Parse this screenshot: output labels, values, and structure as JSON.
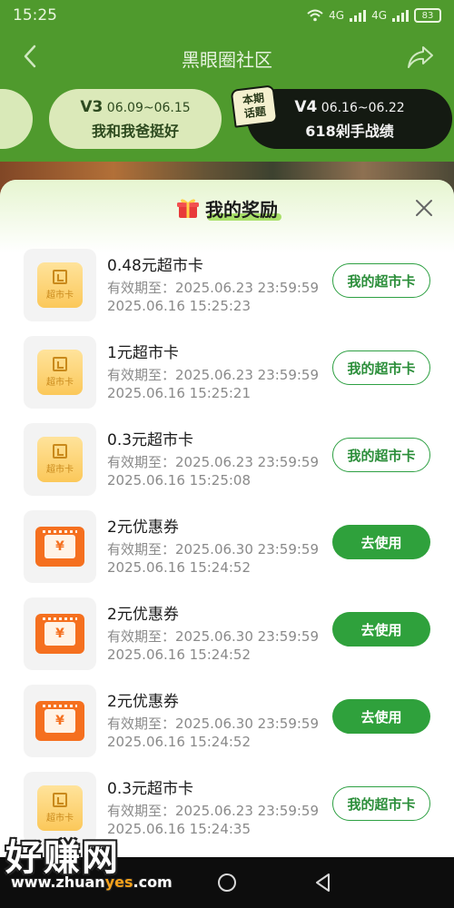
{
  "status_bar": {
    "time": "15:25",
    "signal1": "4G",
    "signal2": "4G",
    "battery": "83"
  },
  "header": {
    "title": "黑眼圈社区"
  },
  "topics": {
    "prev_fragment": "",
    "items": [
      {
        "code": "V3",
        "dates": "06.09~06.15",
        "title": "我和我爸挺好"
      },
      {
        "code": "V4",
        "dates": "06.16~06.22",
        "title": "618剁手战绩"
      }
    ],
    "badge": "本期\n话题"
  },
  "sheet": {
    "title": "我的奖励",
    "rewards": [
      {
        "type": "card",
        "icon_label": "超市卡",
        "title": "0.48元超市卡",
        "valid": "有效期至：2025.06.23 23:59:59",
        "time": "2025.06.16 15:25:23",
        "action": "我的超市卡",
        "action_style": "outline"
      },
      {
        "type": "card",
        "icon_label": "超市卡",
        "title": "1元超市卡",
        "valid": "有效期至：2025.06.23 23:59:59",
        "time": "2025.06.16 15:25:21",
        "action": "我的超市卡",
        "action_style": "outline"
      },
      {
        "type": "card",
        "icon_label": "超市卡",
        "title": "0.3元超市卡",
        "valid": "有效期至：2025.06.23 23:59:59",
        "time": "2025.06.16 15:25:08",
        "action": "我的超市卡",
        "action_style": "outline"
      },
      {
        "type": "coupon",
        "icon_label": "¥",
        "title": "2元优惠券",
        "valid": "有效期至：2025.06.30 23:59:59",
        "time": "2025.06.16 15:24:52",
        "action": "去使用",
        "action_style": "solid"
      },
      {
        "type": "coupon",
        "icon_label": "¥",
        "title": "2元优惠券",
        "valid": "有效期至：2025.06.30 23:59:59",
        "time": "2025.06.16 15:24:52",
        "action": "去使用",
        "action_style": "solid"
      },
      {
        "type": "coupon",
        "icon_label": "¥",
        "title": "2元优惠券",
        "valid": "有效期至：2025.06.30 23:59:59",
        "time": "2025.06.16 15:24:52",
        "action": "去使用",
        "action_style": "solid"
      },
      {
        "type": "card",
        "icon_label": "超市卡",
        "title": "0.3元超市卡",
        "valid": "有效期至：2025.06.23 23:59:59",
        "time": "2025.06.16 15:24:35",
        "action": "我的超市卡",
        "action_style": "outline"
      }
    ]
  },
  "watermark": {
    "cn": "好赚网",
    "url_pre": "www.zhuan",
    "url_hl": "yes",
    "url_post": ".com"
  },
  "colors": {
    "brand_green": "#4f9a2d",
    "button_green": "#2fa13c",
    "coupon_orange": "#f5701f",
    "card_gold": "#fbc85a"
  }
}
